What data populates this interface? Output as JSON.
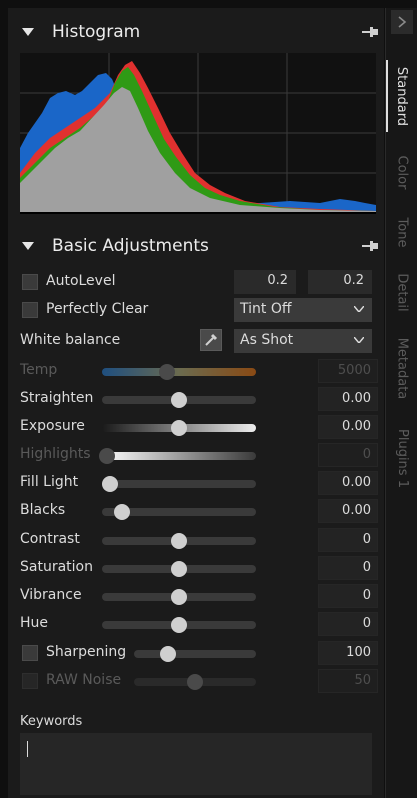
{
  "histogram": {
    "title": "Histogram"
  },
  "basic": {
    "title": "Basic Adjustments"
  },
  "autolevel": {
    "label": "AutoLevel",
    "values": [
      "0.2",
      "0.2"
    ]
  },
  "perfectly_clear": {
    "label": "Perfectly Clear",
    "tint": "Tint Off"
  },
  "white_balance": {
    "label": "White balance",
    "preset": "As Shot"
  },
  "sliders": [
    {
      "label": "Temp",
      "value": "5000",
      "position": 0.42,
      "enabled": false
    },
    {
      "label": "Straighten",
      "value": "0.00",
      "position": 0.5,
      "enabled": true
    },
    {
      "label": "Exposure",
      "value": "0.00",
      "position": 0.5,
      "enabled": true
    },
    {
      "label": "Highlights",
      "value": "0",
      "position": 0.03,
      "enabled": false
    },
    {
      "label": "Fill Light",
      "value": "0.00",
      "position": 0.05,
      "enabled": true
    },
    {
      "label": "Blacks",
      "value": "0.00",
      "position": 0.13,
      "enabled": true
    },
    {
      "label": "Contrast",
      "value": "0",
      "position": 0.5,
      "enabled": true
    },
    {
      "label": "Saturation",
      "value": "0",
      "position": 0.5,
      "enabled": true
    },
    {
      "label": "Vibrance",
      "value": "0",
      "position": 0.5,
      "enabled": true
    },
    {
      "label": "Hue",
      "value": "0",
      "position": 0.5,
      "enabled": true
    }
  ],
  "sharpening": {
    "label": "Sharpening",
    "value": "100",
    "position": 0.28
  },
  "raw_noise": {
    "label": "RAW Noise",
    "value": "50",
    "position": 0.5
  },
  "keywords": {
    "label": "Keywords",
    "value": ""
  },
  "tabs": [
    "Standard",
    "Color",
    "Tone",
    "Detail",
    "Metadata",
    "Plugins 1"
  ],
  "active_tab": "Standard",
  "icons": {
    "collapse": "chevron-right-icon",
    "pin": "pin-icon",
    "eyedropper": "eyedropper-icon",
    "dropdown": "chevron-down-icon"
  },
  "colors": {
    "red": "#e0312f",
    "green": "#2f9a15",
    "blue": "#1a66c8",
    "gray": "#a0a0a0"
  }
}
